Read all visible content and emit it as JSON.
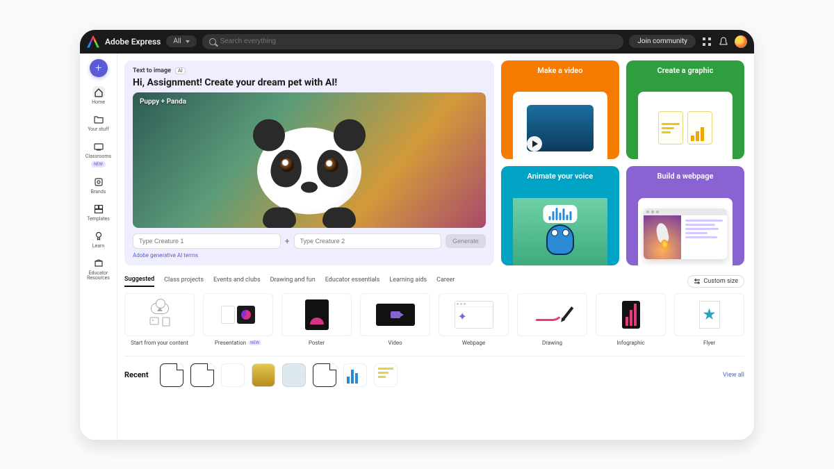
{
  "header": {
    "brand": "Adobe Express",
    "filter_label": "All",
    "search_placeholder": "Search everything",
    "join_label": "Join community"
  },
  "sidebar": {
    "items": [
      {
        "label": "Home",
        "icon": "home-icon"
      },
      {
        "label": "Your stuff",
        "icon": "folder-icon"
      },
      {
        "label": "Classrooms",
        "icon": "classroom-icon",
        "badge": "NEW"
      },
      {
        "label": "Brands",
        "icon": "brand-icon"
      },
      {
        "label": "Templates",
        "icon": "templates-icon"
      },
      {
        "label": "Learn",
        "icon": "learn-icon"
      },
      {
        "label": "Educator Resources",
        "icon": "educator-icon"
      }
    ]
  },
  "tti": {
    "tag": "Text to image",
    "ai_chip": "AI",
    "title": "Hi, Assignment! Create your dream pet with AI!",
    "image_label": "Puppy + Panda",
    "input1_placeholder": "Type Creature 1",
    "input2_placeholder": "Type Creature 2",
    "generate_label": "Generate",
    "terms_label": "Adobe generative AI terms"
  },
  "tiles": [
    {
      "title": "Make a video",
      "color": "#f57c00"
    },
    {
      "title": "Create a graphic",
      "color": "#2e9e3f"
    },
    {
      "title": "Animate your voice",
      "color": "#00a3c4"
    },
    {
      "title": "Build a webpage",
      "color": "#8a63d2"
    }
  ],
  "categories": {
    "tabs": [
      "Suggested",
      "Class projects",
      "Events and clubs",
      "Drawing and fun",
      "Educator essentials",
      "Learning aids",
      "Career"
    ],
    "active": "Suggested",
    "custom_size_label": "Custom size"
  },
  "templates": [
    {
      "label": "Start from your content"
    },
    {
      "label": "Presentation",
      "badge": "NEW"
    },
    {
      "label": "Poster"
    },
    {
      "label": "Video"
    },
    {
      "label": "Webpage"
    },
    {
      "label": "Drawing"
    },
    {
      "label": "Infographic"
    },
    {
      "label": "Flyer"
    }
  ],
  "recent": {
    "title": "Recent",
    "view_all": "View all"
  }
}
